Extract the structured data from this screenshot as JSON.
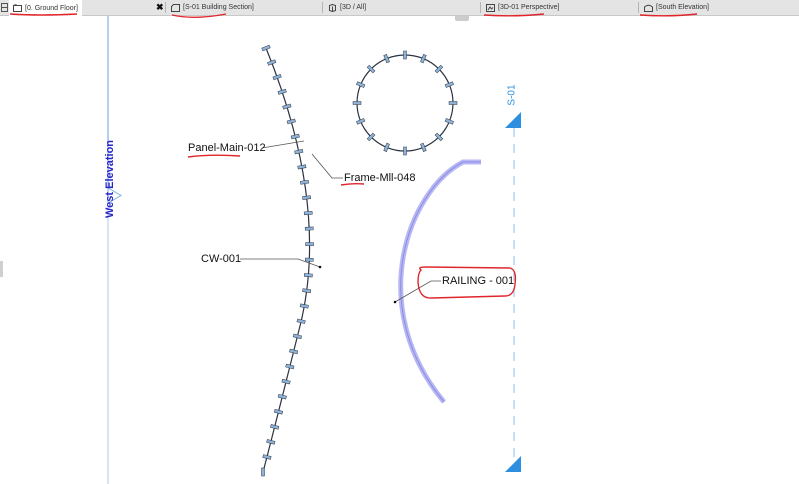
{
  "tabs": [
    {
      "label": "[0. Ground Floor]",
      "icon": "floor-plan-icon",
      "active": true,
      "closable": true
    },
    {
      "label": "[S-01 Building Section]",
      "icon": "section-icon",
      "active": false
    },
    {
      "label": "[3D / All]",
      "icon": "3d-view-icon",
      "active": false
    },
    {
      "label": "[3D-01 Perspective]",
      "icon": "perspective-icon",
      "active": false
    },
    {
      "label": "[South Elevation]",
      "icon": "elevation-icon",
      "active": false
    }
  ],
  "close_glyph": "✖",
  "canvas": {
    "west_elevation_label": "West Elevation",
    "section_label": "S-01",
    "callouts": {
      "panel": "Panel-Main-012",
      "frame": "Frame-Mll-048",
      "curtain_wall": "CW-001",
      "railing": "RAILING - 001"
    }
  },
  "colors": {
    "annotation_red": "#e0262b",
    "elevation_blue": "#2626c8",
    "section_blue": "#2d8fe0",
    "railing_lilac": "#a9a9ee",
    "wall_line": "#2b3340",
    "panel_fill": "#8fb3d8"
  }
}
